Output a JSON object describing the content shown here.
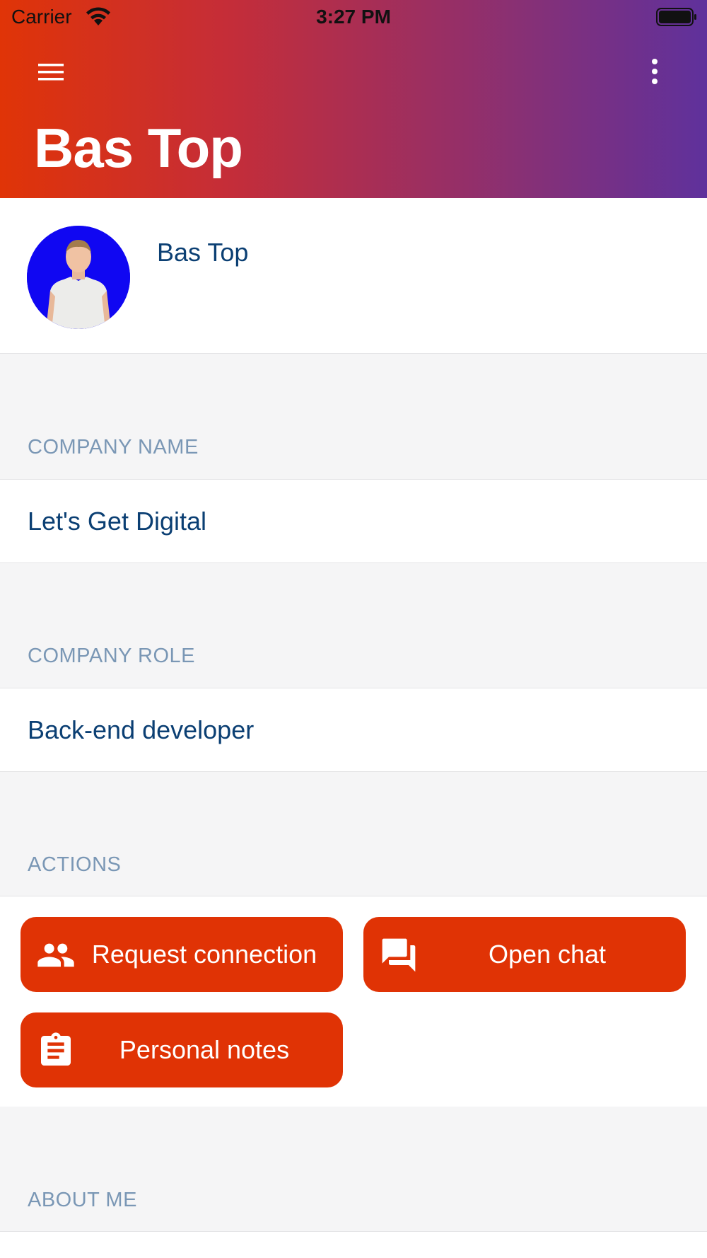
{
  "status_bar": {
    "carrier": "Carrier",
    "time": "3:27 PM"
  },
  "header": {
    "title": "Bas Top",
    "menu_icon": "hamburger-menu-icon",
    "more_icon": "more-vertical-icon",
    "gradient_colors": [
      "#e03407",
      "#9a2f63",
      "#5f319c"
    ]
  },
  "profile": {
    "name": "Bas Top",
    "avatar_background": "#1007f2"
  },
  "sections": {
    "company_name": {
      "label": "COMPANY NAME",
      "value": "Let's Get Digital"
    },
    "company_role": {
      "label": "COMPANY ROLE",
      "value": "Back-end developer"
    },
    "actions": {
      "label": "ACTIONS",
      "buttons": [
        {
          "label": "Request connection",
          "icon": "people-icon"
        },
        {
          "label": "Open chat",
          "icon": "chat-icon"
        },
        {
          "label": "Personal notes",
          "icon": "clipboard-icon"
        }
      ]
    },
    "about_me": {
      "label": "ABOUT ME"
    }
  },
  "colors": {
    "accent": "#e03305",
    "text_primary": "#0b3f73",
    "section_label": "#7a97b5",
    "background": "#f5f5f6"
  }
}
